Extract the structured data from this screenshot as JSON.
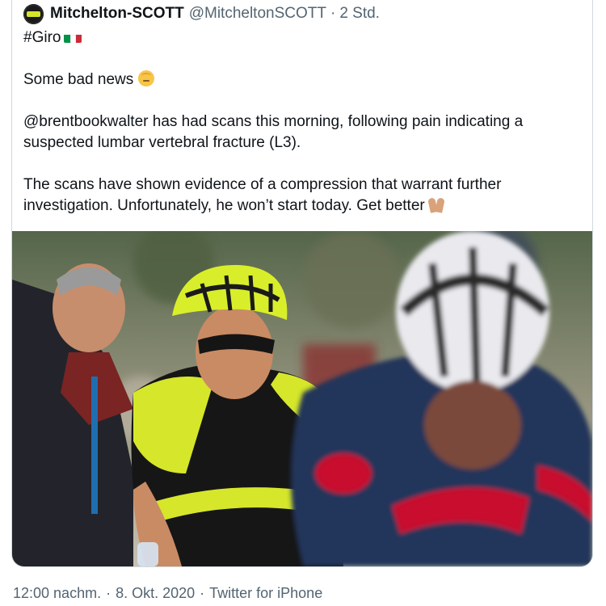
{
  "tweet": {
    "author_name": "Mitchelton-SCOTT",
    "author_handle": "@MitcheltonSCOTT",
    "separator": "·",
    "relative_time": "2 Std.",
    "hashtag_line": "#Giro",
    "line_bad_news": "Some bad news",
    "paragraph_scans": "@brentbookwalter has had scans this morning, following pain indicating a suspected lumbar vertebral fracture (L3).",
    "paragraph_result": "The scans have shown evidence of a compression that warrant further investigation. Unfortunately, he won’t start today. Get better",
    "icons": {
      "flag": "italy-flag-icon",
      "face": "relieved-face-emoji-icon",
      "pray": "folded-hands-emoji-icon"
    },
    "colors": {
      "flag_green": "#009246",
      "flag_white": "#ffffff",
      "flag_red": "#ce2b37",
      "brand_yellow": "#d6e62a",
      "secondary_text": "#536471"
    }
  },
  "footer": {
    "time": "12:00 nachm.",
    "date": "8. Okt. 2020",
    "source": "Twitter for iPhone",
    "separator": "·"
  }
}
